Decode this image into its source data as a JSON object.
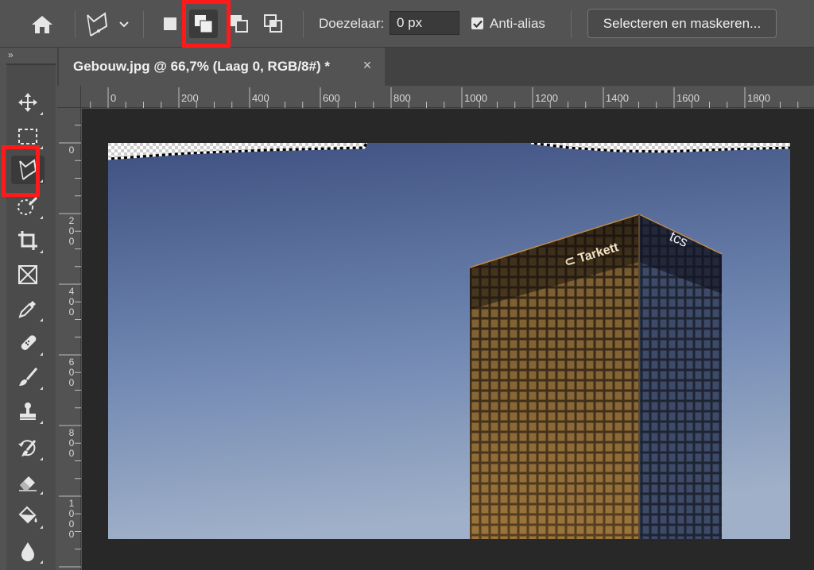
{
  "options_bar": {
    "home_icon": "home-icon",
    "tool_preset_icon": "magnetic-lasso-icon",
    "tool_preset_dropdown_icon": "chevron-down-icon",
    "selection_modes": [
      "new-selection",
      "add-to-selection",
      "subtract-from-selection",
      "intersect-with-selection"
    ],
    "active_mode": "add-to-selection",
    "feather_label": "Doezelaar:",
    "feather_value": "0 px",
    "antialias_label": "Anti-alias",
    "antialias_checked": true,
    "select_and_mask_label": "Selecteren en maskeren..."
  },
  "toolbar": {
    "collapse_label": "»",
    "tools": [
      "move",
      "rectangular-marquee",
      "magnetic-lasso",
      "quick-selection",
      "crop",
      "frame",
      "eyedropper",
      "spot-healing",
      "brush",
      "clone-stamp",
      "history-brush",
      "eraser",
      "paint-bucket",
      "blur"
    ],
    "active_tool": "magnetic-lasso"
  },
  "document": {
    "tab_title": "Gebouw.jpg @ 66,7% (Laag 0, RGB/8#) *",
    "close_label": "×"
  },
  "rulers": {
    "horizontal": [
      "0",
      "200",
      "400",
      "600",
      "800",
      "1000",
      "1200",
      "1400",
      "1600",
      "1800"
    ],
    "vertical": [
      "0",
      "200",
      "400",
      "600",
      "800",
      "1000"
    ]
  },
  "image": {
    "building_signs": [
      "Tarkett",
      "tcs"
    ],
    "sky_top_color": "#3e5080",
    "sky_bottom_color": "#9fb0c8",
    "highlight_color": "#ff1a1a"
  }
}
